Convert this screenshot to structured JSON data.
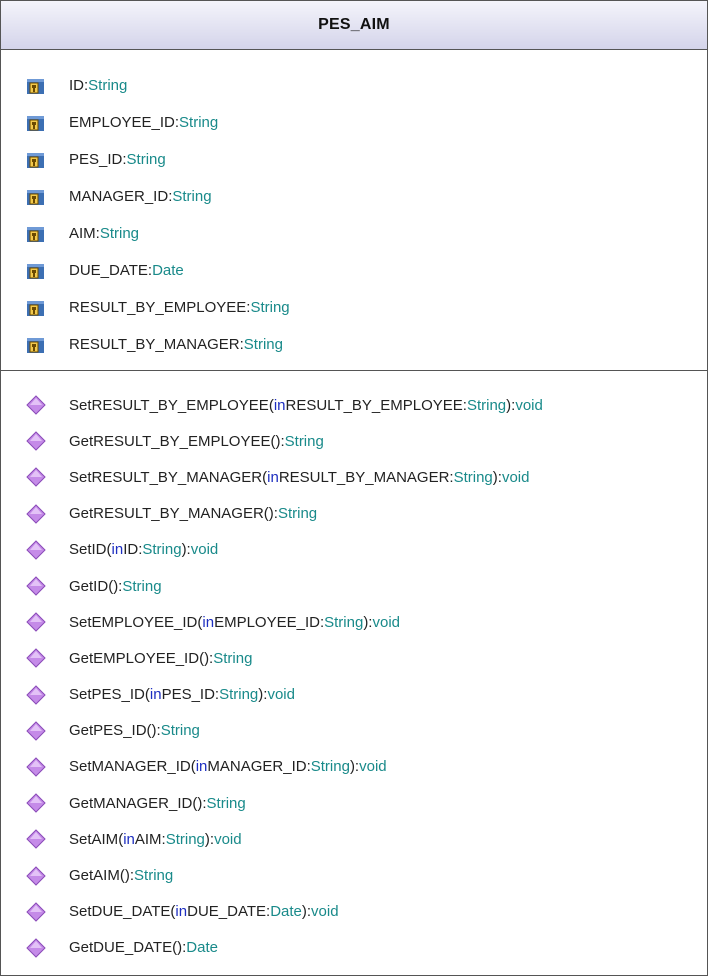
{
  "class_name": "PES_AIM",
  "attributes": [
    {
      "name": "ID",
      "type": "String"
    },
    {
      "name": "EMPLOYEE_ID",
      "type": "String"
    },
    {
      "name": "PES_ID",
      "type": "String"
    },
    {
      "name": "MANAGER_ID",
      "type": "String"
    },
    {
      "name": "AIM",
      "type": "String"
    },
    {
      "name": "DUE_DATE",
      "type": "Date"
    },
    {
      "name": "RESULT_BY_EMPLOYEE",
      "type": "String"
    },
    {
      "name": "RESULT_BY_MANAGER",
      "type": "String"
    }
  ],
  "methods": [
    {
      "name": "SetRESULT_BY_EMPLOYEE",
      "param_kw": "in",
      "param_name": "RESULT_BY_EMPLOYEE",
      "param_type": "String",
      "return_type": "void"
    },
    {
      "name": "GetRESULT_BY_EMPLOYEE",
      "return_type": "String"
    },
    {
      "name": "SetRESULT_BY_MANAGER",
      "param_kw": "in",
      "param_name": "RESULT_BY_MANAGER",
      "param_type": "String",
      "return_type": "void"
    },
    {
      "name": "GetRESULT_BY_MANAGER",
      "return_type": "String"
    },
    {
      "name": "SetID",
      "param_kw": "in",
      "param_name": "ID",
      "param_type": "String",
      "return_type": "void"
    },
    {
      "name": "GetID",
      "return_type": "String"
    },
    {
      "name": "SetEMPLOYEE_ID",
      "param_kw": "in",
      "param_name": "EMPLOYEE_ID",
      "param_type": "String",
      "return_type": "void"
    },
    {
      "name": "GetEMPLOYEE_ID",
      "return_type": "String"
    },
    {
      "name": "SetPES_ID",
      "param_kw": "in",
      "param_name": "PES_ID",
      "param_type": "String",
      "return_type": "void"
    },
    {
      "name": "GetPES_ID",
      "return_type": "String"
    },
    {
      "name": "SetMANAGER_ID",
      "param_kw": "in",
      "param_name": "MANAGER_ID",
      "param_type": "String",
      "return_type": "void"
    },
    {
      "name": "GetMANAGER_ID",
      "return_type": "String"
    },
    {
      "name": "SetAIM",
      "param_kw": "in",
      "param_name": "AIM",
      "param_type": "String",
      "return_type": "void"
    },
    {
      "name": "GetAIM",
      "return_type": "String"
    },
    {
      "name": "SetDUE_DATE",
      "param_kw": "in",
      "param_name": "DUE_DATE",
      "param_type": "Date",
      "return_type": "void"
    },
    {
      "name": "GetDUE_DATE",
      "return_type": "Date"
    }
  ],
  "icons": {
    "attribute": "private-field-icon",
    "method": "public-method-icon"
  },
  "colors": {
    "type": "#198a8a",
    "keyword": "#1d2ec0",
    "text": "#222222",
    "method_icon": "#c58be8",
    "field_icon": "#3c6fb3"
  }
}
